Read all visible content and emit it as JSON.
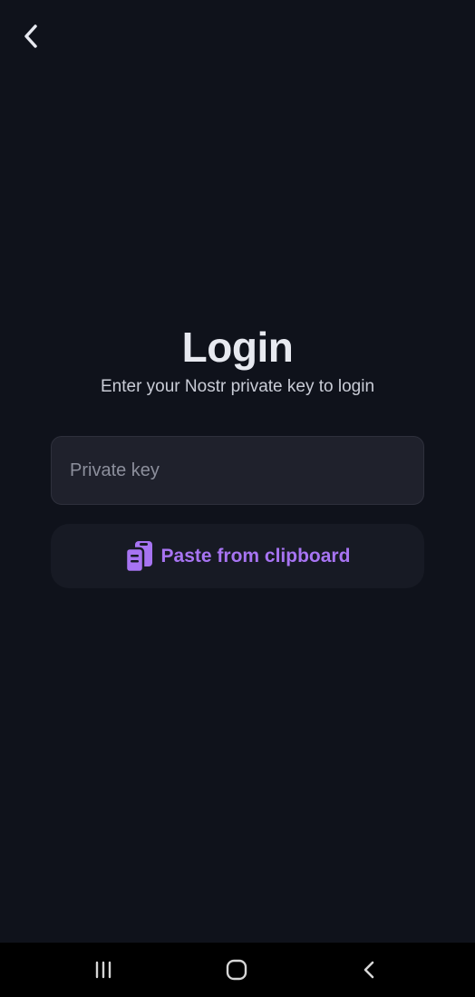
{
  "header": {
    "back_icon": "chevron-left-icon"
  },
  "login": {
    "title": "Login",
    "subtitle": "Enter your Nostr private key to login",
    "input_placeholder": "Private key",
    "input_value": "",
    "paste_label": "Paste from clipboard",
    "paste_icon": "clipboard-icon"
  },
  "navigation": {
    "recent_icon": "recent-apps-icon",
    "home_icon": "home-icon",
    "back_icon": "back-icon"
  },
  "colors": {
    "background": "#0f121b",
    "accent": "#a774f2",
    "input_background": "#1f212c",
    "button_background": "#171a24",
    "title": "#e7e9f0",
    "navbar": "#000000"
  }
}
